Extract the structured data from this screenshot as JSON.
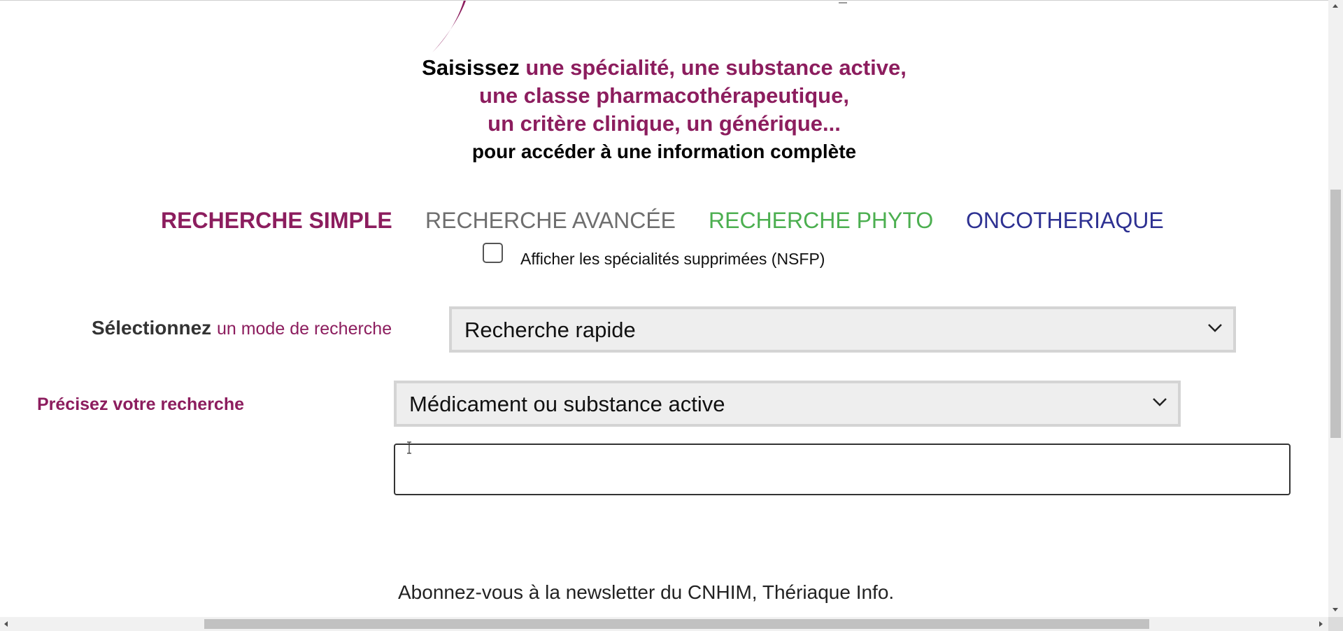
{
  "intro": {
    "lead": "Saisissez",
    "line1": "une spécialité, une substance active,",
    "line2": "une classe pharmacothérapeutique,",
    "line3": "un critère clinique, un générique...",
    "line4": "pour accéder à une information complète"
  },
  "tabs": [
    {
      "label": "RECHERCHE SIMPLE",
      "color": "#8c1d5e"
    },
    {
      "label": "RECHERCHE AVANCÉE",
      "color": "#6e6e6e"
    },
    {
      "label": "RECHERCHE PHYTO",
      "color": "#4caf50"
    },
    {
      "label": "ONCOTHERIAQUE",
      "color": "#2e3192"
    }
  ],
  "nsfp": {
    "label": "Afficher les spécialités supprimées (NSFP)",
    "checked": false
  },
  "mode": {
    "label_strong": "Sélectionnez",
    "label_accent": "un mode de recherche",
    "selected": "Recherche rapide"
  },
  "precise": {
    "label": "Précisez votre recherche",
    "selected": "Médicament ou substance active"
  },
  "search": {
    "value": "",
    "placeholder": ""
  },
  "newsletter": {
    "text": "Abonnez-vous à la newsletter du CNHIM, Thériaque Info."
  },
  "colors": {
    "brand": "#8c1d5e"
  }
}
